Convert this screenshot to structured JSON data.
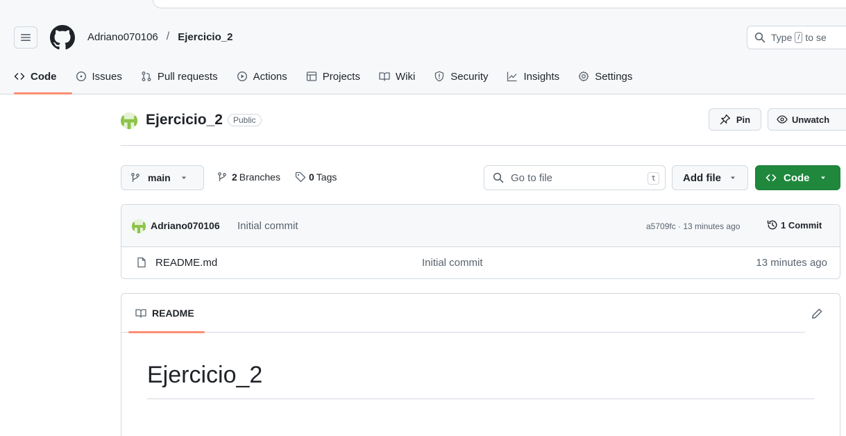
{
  "header": {
    "owner": "Adriano070106",
    "separator": "/",
    "repo": "Ejercicio_2",
    "search_prefix": "Type",
    "search_key": "/",
    "search_suffix": "to se"
  },
  "tabs": [
    {
      "label": "Code",
      "icon": "code-icon"
    },
    {
      "label": "Issues",
      "icon": "issue-icon"
    },
    {
      "label": "Pull requests",
      "icon": "pull-request-icon"
    },
    {
      "label": "Actions",
      "icon": "play-icon"
    },
    {
      "label": "Projects",
      "icon": "table-icon"
    },
    {
      "label": "Wiki",
      "icon": "book-icon"
    },
    {
      "label": "Security",
      "icon": "shield-icon"
    },
    {
      "label": "Insights",
      "icon": "graph-icon"
    },
    {
      "label": "Settings",
      "icon": "gear-icon"
    }
  ],
  "repo": {
    "title": "Ejercicio_2",
    "visibility": "Public",
    "pin_label": "Pin",
    "watch_label": "Unwatch"
  },
  "toolbar": {
    "branch": "main",
    "branches_count": "2",
    "branches_label": "Branches",
    "tags_count": "0",
    "tags_label": "Tags",
    "goto_placeholder": "Go to file",
    "goto_key": "t",
    "add_file_label": "Add file",
    "code_label": "Code"
  },
  "latest_commit": {
    "author": "Adriano070106",
    "message": "Initial commit",
    "meta": "a5709fc · 13 minutes ago",
    "count_label": "1 Commit"
  },
  "files": [
    {
      "name": "README.md",
      "commit": "Initial commit",
      "time": "13 minutes ago"
    }
  ],
  "readme": {
    "tab_label": "README",
    "heading": "Ejercicio_2"
  },
  "colors": {
    "accent_underline": "#fd8c73",
    "code_button": "#1f883d"
  }
}
